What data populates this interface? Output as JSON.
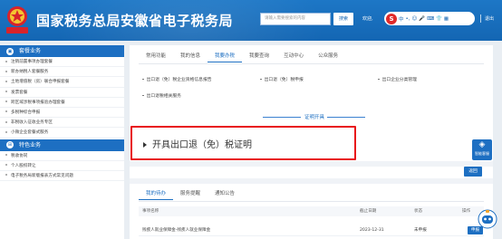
{
  "header": {
    "title": "国家税务总局安徽省电子税务局",
    "search_placeholder": "请输入需要搜索的内容",
    "search_button": "搜索",
    "welcome": "欢迎,",
    "logout": "退出",
    "brand_color": "#1466b3"
  },
  "sidebar": {
    "section1_title": "套餐业务",
    "items1": [
      "注销前置事项办理套餐",
      "新办纳税人套餐服务",
      "土地增值税（房）联合申报套餐",
      "发票套餐",
      "跨区域涉税事项报验办理套餐",
      "多税种综合申报",
      "非税收入征收业务专区",
      "小微企业套餐式服务"
    ],
    "section2_title": "特色业务",
    "items2": [
      "税收协同",
      "个人股权转让",
      "电子税务局新版报表方式常见问题"
    ]
  },
  "main": {
    "tabs": [
      "常用功能",
      "我的信息",
      "我要办税",
      "我要查询",
      "互动中心",
      "公众服务"
    ],
    "active_tab": "我要办税",
    "links": [
      "出口退（免）税企业资格信息报告",
      "出口退（免）税申报",
      "出口企业分类管理",
      "出口退税相关服务"
    ],
    "section_title": "证明开具",
    "highlight_item": "开具出口退（免）税证明",
    "back_button": "返回",
    "tabs2": [
      "我的待办",
      "服务提醒",
      "通知公告"
    ],
    "active_tab2": "我的待办",
    "table": {
      "headers": [
        "事项名称",
        "截止日期",
        "状态",
        "操作"
      ],
      "rows": [
        {
          "name": "残疾人就业保障金-残疾人就业保障金",
          "deadline": "2023-12-31",
          "status": "未申报",
          "action": "申报"
        }
      ]
    }
  },
  "float": {
    "help_label": "智能客服"
  }
}
